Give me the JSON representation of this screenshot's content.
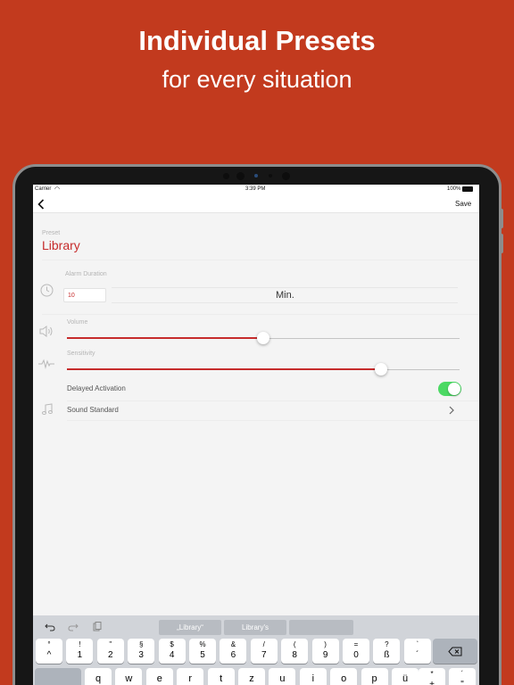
{
  "promo": {
    "title": "Individual Presets",
    "subtitle": "for every situation"
  },
  "status_bar": {
    "carrier": "Carrier",
    "time": "3:39 PM",
    "battery": "100%"
  },
  "nav": {
    "back_icon": "chevron-left-icon",
    "save_label": "Save"
  },
  "preset": {
    "label": "Preset",
    "name": "Library"
  },
  "alarm_duration": {
    "label": "Alarm Duration",
    "value": "10",
    "unit": "Min."
  },
  "volume": {
    "label": "Volume",
    "value": 0.5
  },
  "sensitivity": {
    "label": "Sensitivity",
    "value": 0.8
  },
  "delayed_activation": {
    "label": "Delayed Activation",
    "enabled": true
  },
  "sound": {
    "label": "Sound Standard"
  },
  "keyboard": {
    "suggestions": [
      "„Library“",
      "Library's",
      ""
    ],
    "number_row": [
      {
        "top": "°",
        "bottom": "^"
      },
      {
        "top": "!",
        "bottom": "1"
      },
      {
        "top": "\"",
        "bottom": "2"
      },
      {
        "top": "§",
        "bottom": "3"
      },
      {
        "top": "$",
        "bottom": "4"
      },
      {
        "top": "%",
        "bottom": "5"
      },
      {
        "top": "&",
        "bottom": "6"
      },
      {
        "top": "/",
        "bottom": "7"
      },
      {
        "top": "(",
        "bottom": "8"
      },
      {
        "top": ")",
        "bottom": "9"
      },
      {
        "top": "=",
        "bottom": "0"
      },
      {
        "top": "?",
        "bottom": "ß"
      },
      {
        "top": "`",
        "bottom": "´"
      }
    ],
    "letter_row": [
      "q",
      "w",
      "e",
      "r",
      "t",
      "z",
      "u",
      "i",
      "o",
      "p",
      "ü"
    ],
    "letter_row_extra": {
      "top": "*",
      "bottom": "+"
    },
    "letter_row_extra2": {
      "top": "´",
      "bottom": "\""
    },
    "colors": {
      "accent": "#c62c2c",
      "promo_background": "#c23a1e",
      "toggle_on": "#4cd964"
    }
  }
}
